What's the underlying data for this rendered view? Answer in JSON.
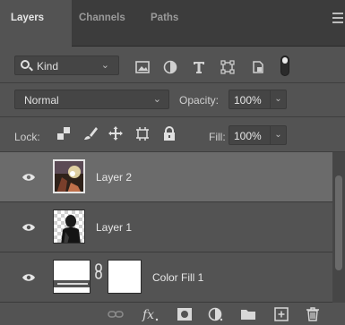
{
  "tabs": [
    {
      "label": "Layers",
      "active": true
    },
    {
      "label": "Channels",
      "active": false
    },
    {
      "label": "Paths",
      "active": false
    }
  ],
  "filter": {
    "kind_label": "Kind",
    "icons": [
      "image-filter-icon",
      "adjustment-filter-icon",
      "type-filter-icon",
      "shape-filter-icon",
      "smart-object-filter-icon",
      "filter-toggle-icon"
    ]
  },
  "blend": {
    "mode": "Normal",
    "opacity_label": "Opacity:",
    "opacity_value": "100%"
  },
  "lock": {
    "label": "Lock:",
    "icons": [
      "lock-transparent-icon",
      "lock-image-icon",
      "lock-position-icon",
      "lock-artboard-icon",
      "lock-all-icon"
    ],
    "fill_label": "Fill:",
    "fill_value": "100%"
  },
  "layers": [
    {
      "name": "Layer 2",
      "visible": true,
      "selected": true
    },
    {
      "name": "Layer 1",
      "visible": true,
      "selected": false
    },
    {
      "name": "Color Fill 1",
      "visible": true,
      "selected": false
    }
  ],
  "bottom_icons": [
    "link-layers-icon",
    "fx-icon",
    "add-mask-icon",
    "new-adjustment-icon",
    "new-group-icon",
    "new-layer-icon",
    "delete-layer-icon"
  ],
  "colors": {
    "panel_bg": "#535353",
    "tabbar_bg": "#3c3c3c",
    "selected_row": "#6b6b6b"
  }
}
